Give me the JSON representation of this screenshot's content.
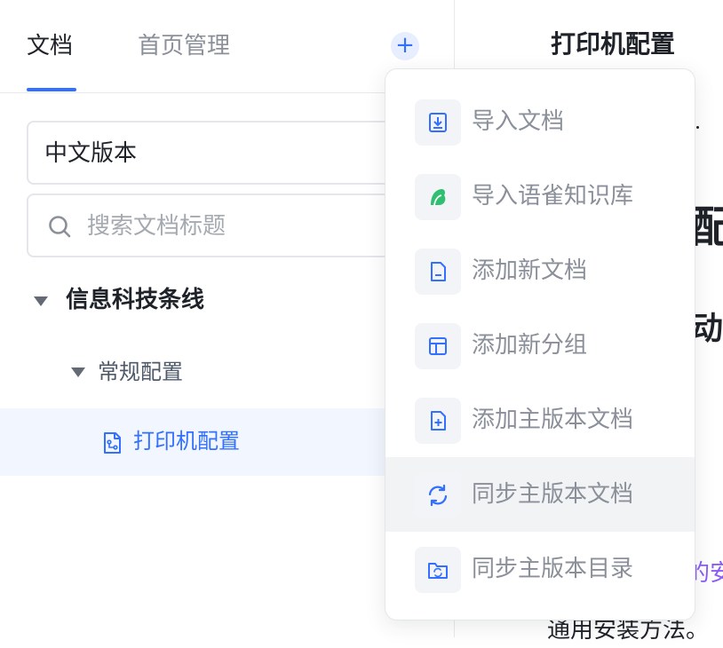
{
  "tabs": {
    "docs": "文档",
    "home_manage": "首页管理"
  },
  "add_button": "+",
  "version_select": {
    "value": "中文版本"
  },
  "search": {
    "placeholder": "搜索文档标题"
  },
  "tree": {
    "group": "信息科技条线",
    "subgroup": "常规配置",
    "doc": "打印机配置"
  },
  "content": {
    "title": "打印机配置",
    "fragment_heading": "配",
    "fragment_sub": "动",
    "fragment_link": "的安",
    "fragment_text": "通用安装方法。"
  },
  "menu": {
    "items": [
      {
        "label": "导入文档",
        "icon": "import-doc-icon"
      },
      {
        "label": "导入语雀知识库",
        "icon": "yuque-icon"
      },
      {
        "label": "添加新文档",
        "icon": "new-doc-icon"
      },
      {
        "label": "添加新分组",
        "icon": "new-group-icon"
      },
      {
        "label": "添加主版本文档",
        "icon": "add-master-doc-icon"
      },
      {
        "label": "同步主版本文档",
        "icon": "sync-icon"
      },
      {
        "label": "同步主版本目录",
        "icon": "sync-folder-icon"
      }
    ],
    "highlighted_index": 5
  },
  "colors": {
    "accent": "#3370ff",
    "yuque_green": "#2fbf71",
    "link_purple": "#8b5cf6"
  }
}
